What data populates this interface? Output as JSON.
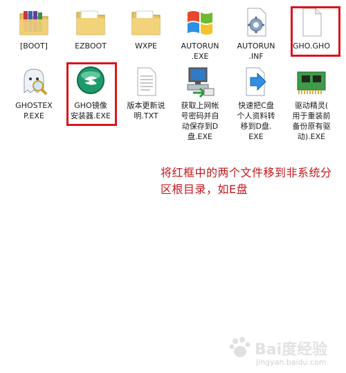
{
  "files": [
    {
      "name": "[BOOT]",
      "icon": "folder-icon"
    },
    {
      "name": "EZBOOT",
      "icon": "folder-icon"
    },
    {
      "name": "WXPE",
      "icon": "folder-icon"
    },
    {
      "name": "AUTORUN\n.EXE",
      "icon": "windows-logo-icon"
    },
    {
      "name": "AUTORUN\n.INF",
      "icon": "gear-document-icon"
    },
    {
      "name": "GHO.GHO",
      "icon": "blank-file-icon"
    },
    {
      "name": "GHOSTEX\nP.EXE",
      "icon": "ghost-magnifier-icon"
    },
    {
      "name": "GHO镜像\n安装器.EXE",
      "icon": "ghost-installer-icon"
    },
    {
      "name": "版本更新说\n明.TXT",
      "icon": "text-file-icon"
    },
    {
      "name": "获取上网帐\n号密码并自\n动保存到D\n盘.EXE",
      "icon": "computer-arrow-icon"
    },
    {
      "name": "快速把C盘\n个人资料转\n移到D盘.\nEXE",
      "icon": "document-arrow-icon"
    },
    {
      "name": "驱动精灵(\n用于重装前\n备份原有驱\n动).EXE",
      "icon": "circuit-board-icon"
    }
  ],
  "annotation": "将红框中的两个文件移到非系统分区根目录，如E盘",
  "watermark": {
    "brand": "Bai度经验",
    "url": "jingyan.baidu.com"
  },
  "colors": {
    "highlight": "#d8141b",
    "annotation_text": "#c3161c",
    "folder": "#e8c25a"
  }
}
